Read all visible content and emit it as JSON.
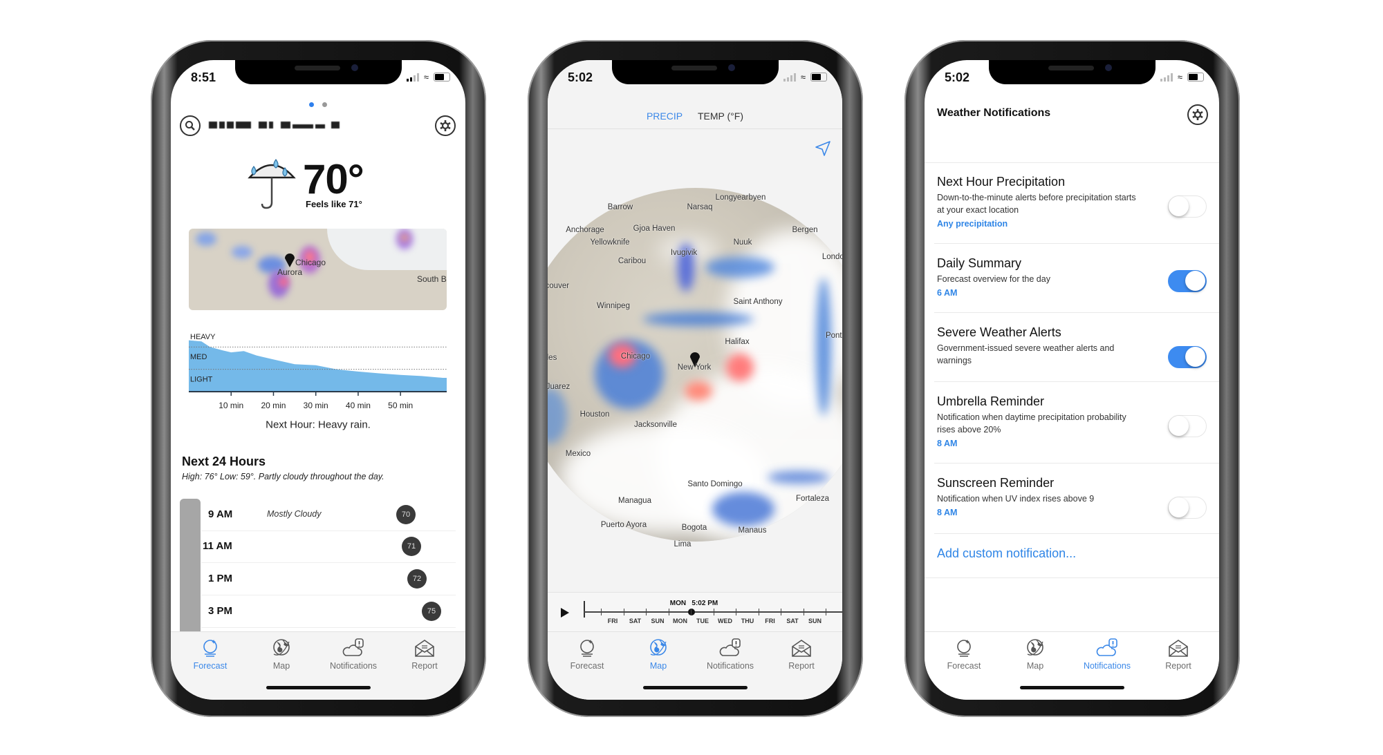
{
  "accent_color": "#3b88e8",
  "tabbar": {
    "tabs": [
      {
        "label": "Forecast",
        "icon": "crystal-ball-icon"
      },
      {
        "label": "Map",
        "icon": "globe-icon"
      },
      {
        "label": "Notifications",
        "icon": "cloud-alert-icon"
      },
      {
        "label": "Report",
        "icon": "envelope-icon"
      }
    ]
  },
  "forecast_screen": {
    "status_time": "8:51",
    "active_tab": 0,
    "page_dots": {
      "count": 2,
      "active": 0
    },
    "current": {
      "temperature": "70°",
      "feels_like": "Feels like 71°",
      "icon": "umbrella-rain-icon"
    },
    "radar_labels": [
      "Chicago",
      "Aurora",
      "South B"
    ],
    "precip_summary": "Next Hour: Heavy rain.",
    "next24": {
      "title": "Next 24 Hours",
      "summary": "High: 76° Low: 59°. Partly cloudy throughout the day.",
      "hours": [
        {
          "time": "9 AM",
          "condition": "Mostly Cloudy",
          "temp": "70"
        },
        {
          "time": "11 AM",
          "condition": "",
          "temp": "71"
        },
        {
          "time": "1 PM",
          "condition": "",
          "temp": "72"
        },
        {
          "time": "3 PM",
          "condition": "",
          "temp": "75"
        }
      ]
    }
  },
  "chart_data": {
    "type": "area",
    "title": "",
    "xlabel": "",
    "ylabel": "",
    "x_ticks": [
      "10 min",
      "20 min",
      "30 min",
      "40 min",
      "50 min"
    ],
    "y_levels": [
      "LIGHT",
      "MED",
      "HEAVY"
    ],
    "xlim": [
      0,
      60
    ],
    "ylim": [
      0,
      3
    ],
    "grid": "dotted lines at level boundaries",
    "color": "#74b9e9",
    "x": [
      0,
      3,
      5,
      8,
      10,
      13,
      16,
      20,
      25,
      30,
      35,
      40,
      45,
      50,
      55,
      60
    ],
    "values": [
      2.3,
      2.25,
      2.0,
      1.85,
      1.76,
      1.82,
      1.62,
      1.44,
      1.23,
      1.18,
      1.0,
      0.9,
      0.82,
      0.75,
      0.7,
      0.62
    ]
  },
  "map_screen": {
    "status_time": "5:02",
    "active_tab": 1,
    "layer_tabs": [
      {
        "label": "PRECIP",
        "active": true
      },
      {
        "label": "TEMP (°F)",
        "active": false
      }
    ],
    "cities": [
      "Longyearbyen",
      "Barrow",
      "Narsaq",
      "Anchorage",
      "Gjoa Haven",
      "Bergen",
      "Yellowknife",
      "Nuuk",
      "Ivugivik",
      "London",
      "Caribou",
      "Vancouver",
      "Winnipeg",
      "Saint Anthony",
      "Halifax",
      "Ponta Delgada",
      "Chicago",
      "New York",
      "Los Angeles",
      "Juarez",
      "Houston",
      "Jacksonville",
      "Mexico",
      "Santo Domingo",
      "Fortaleza",
      "Managua",
      "Puerto Ayora",
      "Bogota",
      "Manaus",
      "Lima"
    ],
    "timeline": {
      "current": "MON   5:02 PM",
      "days": [
        "FRI",
        "SAT",
        "SUN",
        "MON",
        "TUE",
        "WED",
        "THU",
        "FRI",
        "SAT",
        "SUN"
      ]
    }
  },
  "notifications_screen": {
    "status_time": "5:02",
    "active_tab": 2,
    "title": "Weather Notifications",
    "items": [
      {
        "title": "Next Hour Precipitation",
        "description": "Down-to-the-minute alerts before precipitation starts at your exact location",
        "option": "Any precipitation",
        "enabled": false
      },
      {
        "title": "Daily Summary",
        "description": "Forecast overview for the day",
        "option": "6 AM",
        "enabled": true
      },
      {
        "title": "Severe Weather Alerts",
        "description": "Government-issued severe weather alerts and warnings",
        "option": "",
        "enabled": true
      },
      {
        "title": "Umbrella Reminder",
        "description": "Notification when daytime precipitation probability rises above 20%",
        "option": "8 AM",
        "enabled": false
      },
      {
        "title": "Sunscreen Reminder",
        "description": "Notification when UV index rises above 9",
        "option": "8 AM",
        "enabled": false
      }
    ],
    "add_custom": "Add custom notification..."
  }
}
